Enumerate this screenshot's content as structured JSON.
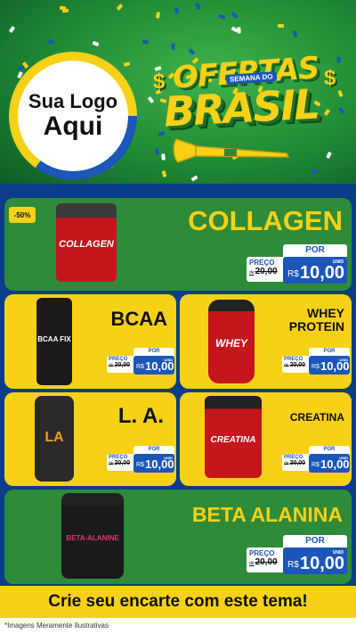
{
  "header": {
    "logo_line1": "Sua Logo",
    "logo_line2": "Aqui",
    "title_top": "OFERTAS",
    "title_sub": "SEMANA DO",
    "title_main": "BRASIL",
    "dollar": "$"
  },
  "discount_badge": "-50%",
  "products": [
    {
      "name": "COLLAGEN",
      "por": "POR",
      "preco_label": "PREÇO",
      "de": "de",
      "old": "20,00",
      "currency": "R$",
      "new": "10,00",
      "unit": "UNID",
      "jar_label": "COLLAGEN"
    },
    {
      "name": "BCAA",
      "por": "POR",
      "preco_label": "PREÇO",
      "de": "de",
      "old": "20,00",
      "currency": "R$",
      "new": "10,00",
      "unit": "UNID",
      "jar_label": "BCAA FIX"
    },
    {
      "name_l1": "WHEY",
      "name_l2": "PROTEIN",
      "por": "POR",
      "preco_label": "PREÇO",
      "de": "de",
      "old": "20,00",
      "currency": "R$",
      "new": "10,00",
      "unit": "UNID",
      "jar_label": "WHEY"
    },
    {
      "name": "L. A.",
      "por": "POR",
      "preco_label": "PREÇO",
      "de": "de",
      "old": "20,00",
      "currency": "R$",
      "new": "10,00",
      "unit": "UNID",
      "jar_label": "LA"
    },
    {
      "name": "CREATINA",
      "por": "POR",
      "preco_label": "PREÇO",
      "de": "de",
      "old": "20,00",
      "currency": "R$",
      "new": "10,00",
      "unit": "UNID",
      "jar_label": "CREATINA"
    },
    {
      "name": "BETA ALANINA",
      "por": "POR",
      "preco_label": "PREÇO",
      "de": "de",
      "old": "20,00",
      "currency": "R$",
      "new": "10,00",
      "unit": "UNID",
      "jar_label": "BETA-ALANINE"
    }
  ],
  "cta": "Crie seu encarte com este tema!",
  "footnote": "*Imagens Meramente Ilustrativas",
  "colors": {
    "green": "#2e8b3a",
    "yellow": "#f7d117",
    "blue": "#1b56b8",
    "navy": "#0b3d8a"
  }
}
